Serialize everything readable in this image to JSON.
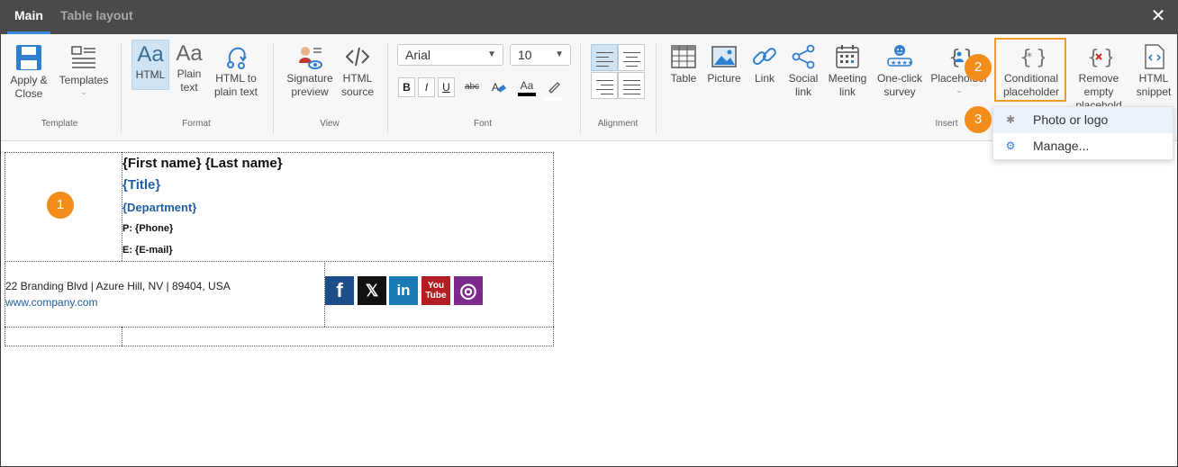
{
  "tabs": [
    {
      "label": "Main"
    },
    {
      "label": "Table layout"
    }
  ],
  "close_label": "✕",
  "ribbon": {
    "template": {
      "group_label": "Template",
      "apply_close": "Apply &\nClose",
      "templates": "Templates"
    },
    "format": {
      "group_label": "Format",
      "html": "HTML",
      "plain_text": "Plain\ntext",
      "html_to_plain": "HTML to\nplain text",
      "aa_glyph": "Aa"
    },
    "view": {
      "group_label": "View",
      "signature_preview": "Signature\npreview",
      "html_source": "HTML\nsource"
    },
    "font": {
      "group_label": "Font",
      "font_name": "Arial",
      "font_size": "10",
      "bold": "B",
      "italic": "I",
      "underline": "U",
      "strike": "abc",
      "font_color": "Aa"
    },
    "alignment": {
      "group_label": "Alignment"
    },
    "insert": {
      "group_label": "Insert",
      "table": "Table",
      "picture": "Picture",
      "link": "Link",
      "social_link": "Social\nlink",
      "meeting_link": "Meeting\nlink",
      "survey": "One-click\nsurvey",
      "placeholder": "Placeholder",
      "conditional_placeholder": "Conditional\nplaceholder",
      "remove_empty": "Remove\nempty\nplacehold",
      "html_snippet": "HTML\nsnippet"
    }
  },
  "dropdown": {
    "items": [
      {
        "label": "Photo or logo"
      },
      {
        "label": "Manage..."
      }
    ]
  },
  "badges": [
    "1",
    "2",
    "3"
  ],
  "signature": {
    "name": "{First name} {Last name}",
    "title": "{Title}",
    "department": "{Department}",
    "phone": "P: {Phone}",
    "email": "E: {E-mail}",
    "address": "22 Branding Blvd | Azure Hill, NV | 89404, USA",
    "website": "www.company.com"
  },
  "social": [
    {
      "name": "facebook",
      "glyph": "f",
      "color": "#1c4f8a"
    },
    {
      "name": "x",
      "glyph": "𝕏",
      "color": "#111111"
    },
    {
      "name": "linkedin",
      "glyph": "in",
      "color": "#1a7bb5"
    },
    {
      "name": "youtube",
      "glyph": "You\nTube",
      "color": "#b31e22"
    },
    {
      "name": "instagram",
      "glyph": "◎",
      "color": "#7c2a8e"
    }
  ],
  "colors": {
    "accent": "#3d8be0",
    "title_blue": "#1f5fa6",
    "badge": "#f28c1a",
    "highlight": "#f39a2c"
  }
}
